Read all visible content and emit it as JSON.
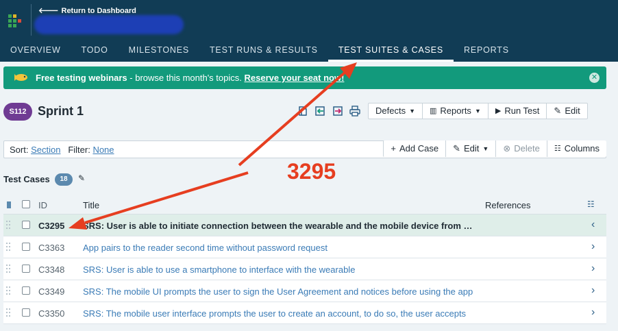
{
  "header": {
    "return_label": "Return to Dashboard",
    "nav": [
      "OVERVIEW",
      "TODO",
      "MILESTONES",
      "TEST RUNS & RESULTS",
      "TEST SUITES & CASES",
      "REPORTS"
    ],
    "active_nav": "TEST SUITES & CASES"
  },
  "banner": {
    "bold": "Free testing webinars",
    "text": " - browse this month's topics. ",
    "link": "Reserve your seat now!",
    "color": "#129a7c"
  },
  "suite": {
    "badge": "S112",
    "badge_color": "#6f3b93",
    "title": "Sprint 1",
    "buttons": {
      "defects": "Defects",
      "reports": "Reports",
      "run_test": "Run Test",
      "edit": "Edit"
    }
  },
  "toolbar": {
    "sort_label": "Sort:",
    "sort_value": "Section",
    "filter_label": "Filter:",
    "filter_value": "None",
    "add_case": "Add Case",
    "edit": "Edit",
    "delete": "Delete",
    "columns": "Columns"
  },
  "section": {
    "title": "Test Cases",
    "count": "18"
  },
  "annotation": "3295",
  "table": {
    "headers": {
      "id": "ID",
      "title": "Title",
      "references": "References"
    },
    "rows": [
      {
        "id": "C3295",
        "title": "SRS: User is able to initiate connection between the wearable and the mobile device from the app",
        "selected": true
      },
      {
        "id": "C3363",
        "title": "App pairs to the reader second time without password request"
      },
      {
        "id": "C3348",
        "title": "SRS: User is able to use a smartphone to interface with the wearable"
      },
      {
        "id": "C3349",
        "title": "SRS: The mobile UI prompts the user to sign the User Agreement and notices before using the app"
      },
      {
        "id": "C3350",
        "title": "SRS: The mobile user interface prompts the user to create an account, to do so, the user accepts"
      }
    ]
  },
  "colors": {
    "header_bg": "#113c55",
    "annotation": "#e63e20",
    "link": "#3a7bb6"
  }
}
